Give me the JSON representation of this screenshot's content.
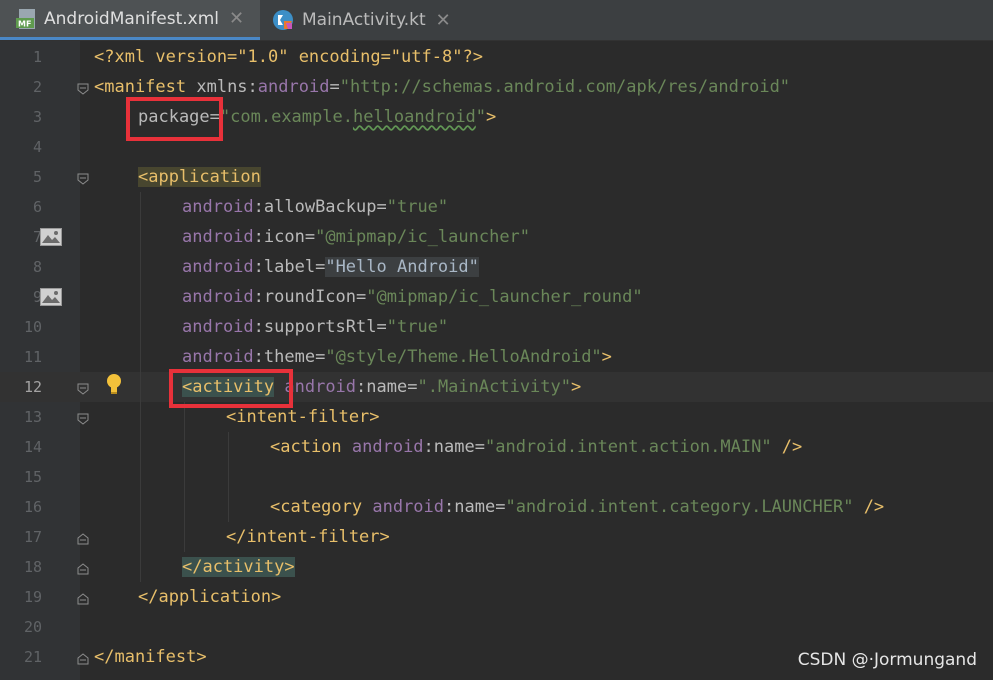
{
  "tabs": [
    {
      "label": "AndroidManifest.xml",
      "icon": "manifest-file-icon",
      "active": true,
      "icon_text": "MF"
    },
    {
      "label": "MainActivity.kt",
      "icon": "kotlin-class-icon",
      "active": false
    }
  ],
  "close_glyph": "✕",
  "line_numbers": [
    "1",
    "2",
    "3",
    "4",
    "5",
    "6",
    "7",
    "8",
    "9",
    "10",
    "11",
    "12",
    "13",
    "14",
    "15",
    "16",
    "17",
    "18",
    "19",
    "20",
    "21"
  ],
  "current_line": 12,
  "code": {
    "l1": "<?xml version=\"1.0\" encoding=\"utf-8\"?>",
    "l2_tag": "<manifest ",
    "l2_attr": "xmlns",
    "l2_colon": ":",
    "l2_ns": "android",
    "l2_eq": "=",
    "l2_val": "\"http://schemas.android.com/apk/res/android\"",
    "l3_attr": "package",
    "l3_eq": "=",
    "l3_val_a": "\"com.example.",
    "l3_val_b": "helloandroid",
    "l3_val_c": "\"",
    "l3_end": ">",
    "l5_tag": "<application",
    "l6_ns": "android",
    "l6_attr": ":allowBackup",
    "l6_eq": "=",
    "l6_val": "\"true\"",
    "l7_ns": "android",
    "l7_attr": ":icon",
    "l7_eq": "=",
    "l7_val": "\"@mipmap/ic_launcher\"",
    "l8_ns": "android",
    "l8_attr": ":label",
    "l8_eq": "=",
    "l8_val": "\"Hello Android\"",
    "l9_ns": "android",
    "l9_attr": ":roundIcon",
    "l9_eq": "=",
    "l9_val": "\"@mipmap/ic_launcher_round\"",
    "l10_ns": "android",
    "l10_attr": ":supportsRtl",
    "l10_eq": "=",
    "l10_val": "\"true\"",
    "l11_ns": "android",
    "l11_attr": ":theme",
    "l11_eq": "=",
    "l11_val": "\"@style/Theme.HelloAndroid\"",
    "l11_end": ">",
    "l12_tag": "<activity",
    "l12_ns": "android",
    "l12_attr": ":name",
    "l12_eq": "=",
    "l12_val": "\".MainActivity\"",
    "l12_end": ">",
    "l13_tag": "<intent-filter>",
    "l14_tag": "<action ",
    "l14_ns": "android",
    "l14_attr": ":name",
    "l14_eq": "=",
    "l14_val": "\"android.intent.action.MAIN\"",
    "l14_end": " />",
    "l16_tag": "<category ",
    "l16_ns": "android",
    "l16_attr": ":name",
    "l16_eq": "=",
    "l16_val": "\"android.intent.category.LAUNCHER\"",
    "l16_end": " />",
    "l17_tag": "</intent-filter>",
    "l18_tag": "</activity>",
    "l19_tag": "</application>",
    "l21_tag": "</manifest>"
  },
  "watermark": "CSDN @·Jormungand"
}
